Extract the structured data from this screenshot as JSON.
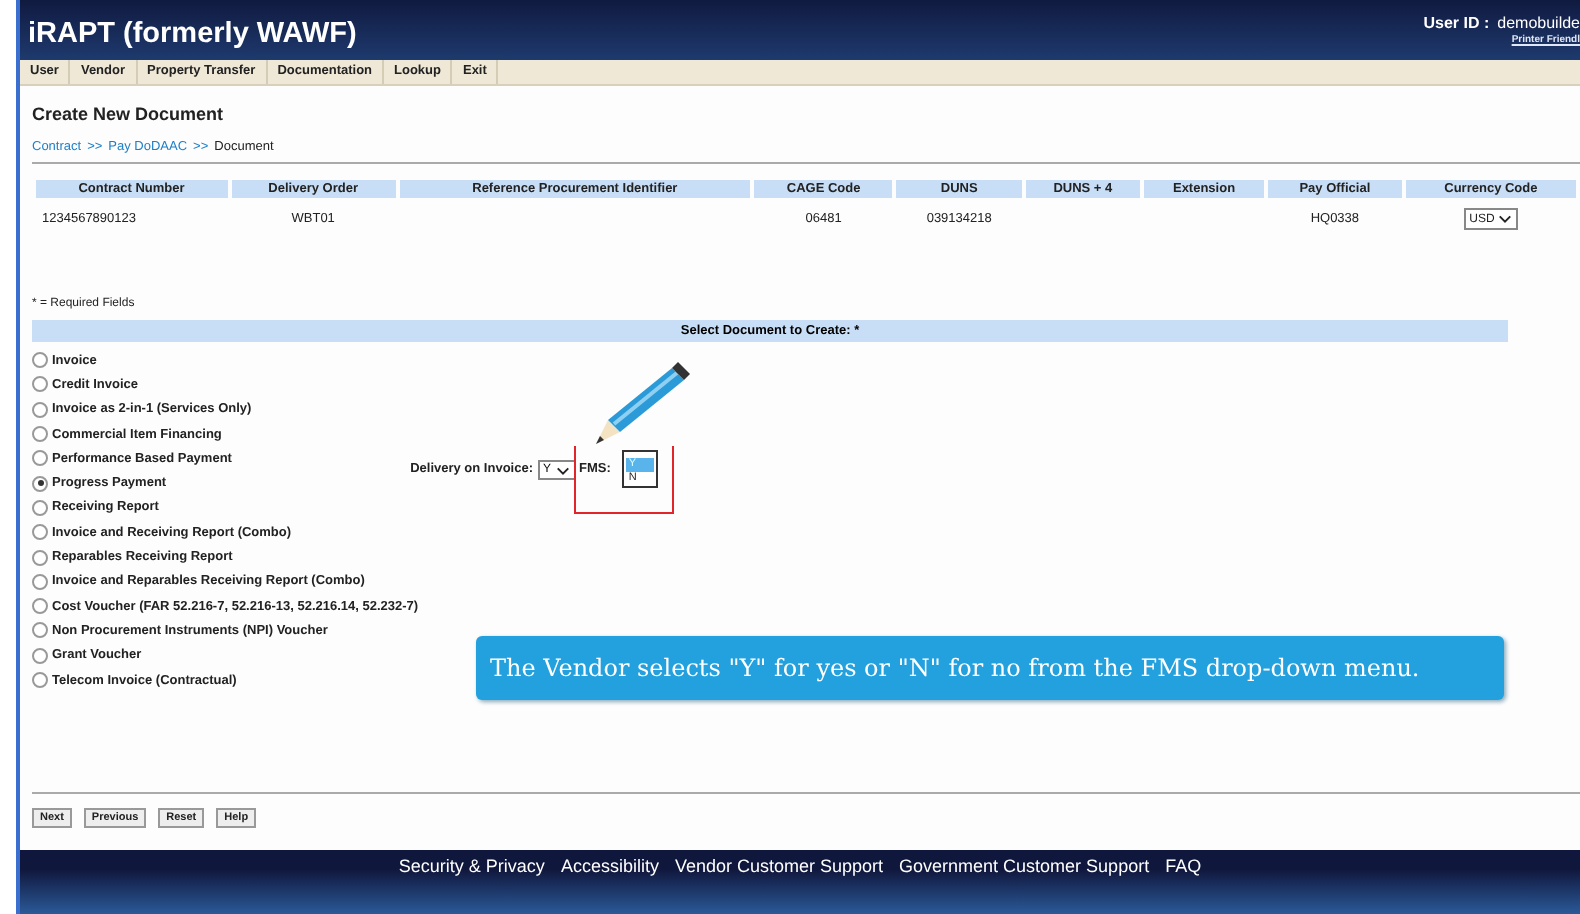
{
  "header": {
    "title": "iRAPT (formerly WAWF)",
    "user_label": "User ID :",
    "user_id": "demobuilde",
    "printer_link": "Printer Friendl"
  },
  "menu": [
    "User",
    "Vendor",
    "Property Transfer",
    "Documentation",
    "Lookup",
    "Exit"
  ],
  "page": {
    "title": "Create New Document",
    "breadcrumb": [
      {
        "label": "Contract",
        "link": true
      },
      {
        "label": ">>",
        "link": true
      },
      {
        "label": "Pay DoDAAC",
        "link": true
      },
      {
        "label": ">>",
        "link": true
      },
      {
        "label": "Document",
        "link": false
      }
    ]
  },
  "table": {
    "columns": [
      "Contract Number",
      "Delivery Order",
      "Reference Procurement Identifier",
      "CAGE Code",
      "DUNS",
      "DUNS + 4",
      "Extension",
      "Pay Official",
      "Currency Code"
    ],
    "row": [
      {
        "kind": "text",
        "value": "1234567890123"
      },
      {
        "kind": "text",
        "value": "WBT01"
      },
      {
        "kind": "empty"
      },
      {
        "kind": "text",
        "value": "06481"
      },
      {
        "kind": "text",
        "value": "039134218"
      },
      {
        "kind": "empty"
      },
      {
        "kind": "empty"
      },
      {
        "kind": "text",
        "value": "HQ0338"
      },
      {
        "kind": "select",
        "value": "USD"
      }
    ]
  },
  "required_note": "* = Required Fields",
  "section_title": "Select Document to Create: *",
  "documents": [
    {
      "label": "Invoice",
      "selected": false
    },
    {
      "label": "Credit Invoice",
      "selected": false
    },
    {
      "label": "Invoice as 2-in-1 (Services Only)",
      "selected": false
    },
    {
      "label": "Commercial Item Financing",
      "selected": false
    },
    {
      "label": "Performance Based Payment",
      "selected": false
    },
    {
      "label": "Progress Payment",
      "selected": true
    },
    {
      "label": "Receiving Report",
      "selected": false
    },
    {
      "label": "Invoice and Receiving Report (Combo)",
      "selected": false
    },
    {
      "label": "Reparables Receiving Report",
      "selected": false
    },
    {
      "label": "Invoice and Reparables Receiving Report (Combo)",
      "selected": false
    },
    {
      "label": "Cost Voucher (FAR 52.216-7, 52.216-13, 52.216.14, 52.232-7)",
      "selected": false
    },
    {
      "label": "Non Procurement Instruments (NPI) Voucher",
      "selected": false
    },
    {
      "label": "Grant Voucher",
      "selected": false
    },
    {
      "label": "Telecom Invoice (Contractual)",
      "selected": false
    }
  ],
  "delivery": {
    "label": "Delivery on Invoice:",
    "value": "Y"
  },
  "fms": {
    "label": "FMS:",
    "options": [
      {
        "label": "Y",
        "selected": true
      },
      {
        "label": "N",
        "selected": false
      }
    ]
  },
  "callout": "The Vendor selects \"Y\" for yes or \"N\" for no from the FMS drop-down menu.",
  "buttons": [
    "Next",
    "Previous",
    "Reset",
    "Help"
  ],
  "footer_links": [
    "Security & Privacy",
    "Accessibility",
    "Vendor Customer Support",
    "Government Customer Support",
    "FAQ"
  ]
}
